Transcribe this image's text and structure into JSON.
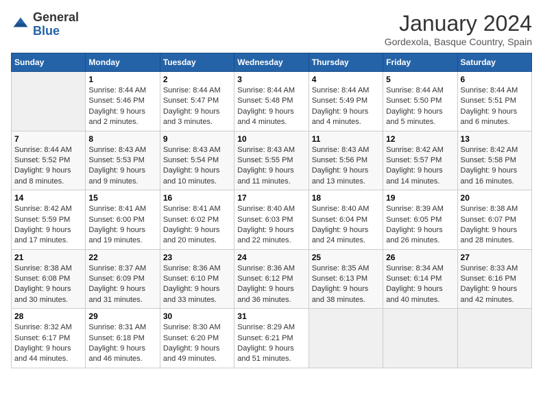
{
  "header": {
    "logo": {
      "general": "General",
      "blue": "Blue"
    },
    "title": "January 2024",
    "subtitle": "Gordexola, Basque Country, Spain"
  },
  "calendar": {
    "days_of_week": [
      "Sunday",
      "Monday",
      "Tuesday",
      "Wednesday",
      "Thursday",
      "Friday",
      "Saturday"
    ],
    "weeks": [
      [
        {
          "day": "",
          "empty": true
        },
        {
          "day": "1",
          "sunrise": "Sunrise: 8:44 AM",
          "sunset": "Sunset: 5:46 PM",
          "daylight": "Daylight: 9 hours and 2 minutes."
        },
        {
          "day": "2",
          "sunrise": "Sunrise: 8:44 AM",
          "sunset": "Sunset: 5:47 PM",
          "daylight": "Daylight: 9 hours and 3 minutes."
        },
        {
          "day": "3",
          "sunrise": "Sunrise: 8:44 AM",
          "sunset": "Sunset: 5:48 PM",
          "daylight": "Daylight: 9 hours and 4 minutes."
        },
        {
          "day": "4",
          "sunrise": "Sunrise: 8:44 AM",
          "sunset": "Sunset: 5:49 PM",
          "daylight": "Daylight: 9 hours and 4 minutes."
        },
        {
          "day": "5",
          "sunrise": "Sunrise: 8:44 AM",
          "sunset": "Sunset: 5:50 PM",
          "daylight": "Daylight: 9 hours and 5 minutes."
        },
        {
          "day": "6",
          "sunrise": "Sunrise: 8:44 AM",
          "sunset": "Sunset: 5:51 PM",
          "daylight": "Daylight: 9 hours and 6 minutes."
        }
      ],
      [
        {
          "day": "7",
          "sunrise": "Sunrise: 8:44 AM",
          "sunset": "Sunset: 5:52 PM",
          "daylight": "Daylight: 9 hours and 8 minutes."
        },
        {
          "day": "8",
          "sunrise": "Sunrise: 8:43 AM",
          "sunset": "Sunset: 5:53 PM",
          "daylight": "Daylight: 9 hours and 9 minutes."
        },
        {
          "day": "9",
          "sunrise": "Sunrise: 8:43 AM",
          "sunset": "Sunset: 5:54 PM",
          "daylight": "Daylight: 9 hours and 10 minutes."
        },
        {
          "day": "10",
          "sunrise": "Sunrise: 8:43 AM",
          "sunset": "Sunset: 5:55 PM",
          "daylight": "Daylight: 9 hours and 11 minutes."
        },
        {
          "day": "11",
          "sunrise": "Sunrise: 8:43 AM",
          "sunset": "Sunset: 5:56 PM",
          "daylight": "Daylight: 9 hours and 13 minutes."
        },
        {
          "day": "12",
          "sunrise": "Sunrise: 8:42 AM",
          "sunset": "Sunset: 5:57 PM",
          "daylight": "Daylight: 9 hours and 14 minutes."
        },
        {
          "day": "13",
          "sunrise": "Sunrise: 8:42 AM",
          "sunset": "Sunset: 5:58 PM",
          "daylight": "Daylight: 9 hours and 16 minutes."
        }
      ],
      [
        {
          "day": "14",
          "sunrise": "Sunrise: 8:42 AM",
          "sunset": "Sunset: 5:59 PM",
          "daylight": "Daylight: 9 hours and 17 minutes."
        },
        {
          "day": "15",
          "sunrise": "Sunrise: 8:41 AM",
          "sunset": "Sunset: 6:00 PM",
          "daylight": "Daylight: 9 hours and 19 minutes."
        },
        {
          "day": "16",
          "sunrise": "Sunrise: 8:41 AM",
          "sunset": "Sunset: 6:02 PM",
          "daylight": "Daylight: 9 hours and 20 minutes."
        },
        {
          "day": "17",
          "sunrise": "Sunrise: 8:40 AM",
          "sunset": "Sunset: 6:03 PM",
          "daylight": "Daylight: 9 hours and 22 minutes."
        },
        {
          "day": "18",
          "sunrise": "Sunrise: 8:40 AM",
          "sunset": "Sunset: 6:04 PM",
          "daylight": "Daylight: 9 hours and 24 minutes."
        },
        {
          "day": "19",
          "sunrise": "Sunrise: 8:39 AM",
          "sunset": "Sunset: 6:05 PM",
          "daylight": "Daylight: 9 hours and 26 minutes."
        },
        {
          "day": "20",
          "sunrise": "Sunrise: 8:38 AM",
          "sunset": "Sunset: 6:07 PM",
          "daylight": "Daylight: 9 hours and 28 minutes."
        }
      ],
      [
        {
          "day": "21",
          "sunrise": "Sunrise: 8:38 AM",
          "sunset": "Sunset: 6:08 PM",
          "daylight": "Daylight: 9 hours and 30 minutes."
        },
        {
          "day": "22",
          "sunrise": "Sunrise: 8:37 AM",
          "sunset": "Sunset: 6:09 PM",
          "daylight": "Daylight: 9 hours and 31 minutes."
        },
        {
          "day": "23",
          "sunrise": "Sunrise: 8:36 AM",
          "sunset": "Sunset: 6:10 PM",
          "daylight": "Daylight: 9 hours and 33 minutes."
        },
        {
          "day": "24",
          "sunrise": "Sunrise: 8:36 AM",
          "sunset": "Sunset: 6:12 PM",
          "daylight": "Daylight: 9 hours and 36 minutes."
        },
        {
          "day": "25",
          "sunrise": "Sunrise: 8:35 AM",
          "sunset": "Sunset: 6:13 PM",
          "daylight": "Daylight: 9 hours and 38 minutes."
        },
        {
          "day": "26",
          "sunrise": "Sunrise: 8:34 AM",
          "sunset": "Sunset: 6:14 PM",
          "daylight": "Daylight: 9 hours and 40 minutes."
        },
        {
          "day": "27",
          "sunrise": "Sunrise: 8:33 AM",
          "sunset": "Sunset: 6:16 PM",
          "daylight": "Daylight: 9 hours and 42 minutes."
        }
      ],
      [
        {
          "day": "28",
          "sunrise": "Sunrise: 8:32 AM",
          "sunset": "Sunset: 6:17 PM",
          "daylight": "Daylight: 9 hours and 44 minutes."
        },
        {
          "day": "29",
          "sunrise": "Sunrise: 8:31 AM",
          "sunset": "Sunset: 6:18 PM",
          "daylight": "Daylight: 9 hours and 46 minutes."
        },
        {
          "day": "30",
          "sunrise": "Sunrise: 8:30 AM",
          "sunset": "Sunset: 6:20 PM",
          "daylight": "Daylight: 9 hours and 49 minutes."
        },
        {
          "day": "31",
          "sunrise": "Sunrise: 8:29 AM",
          "sunset": "Sunset: 6:21 PM",
          "daylight": "Daylight: 9 hours and 51 minutes."
        },
        {
          "day": "",
          "empty": true
        },
        {
          "day": "",
          "empty": true
        },
        {
          "day": "",
          "empty": true
        }
      ]
    ]
  }
}
